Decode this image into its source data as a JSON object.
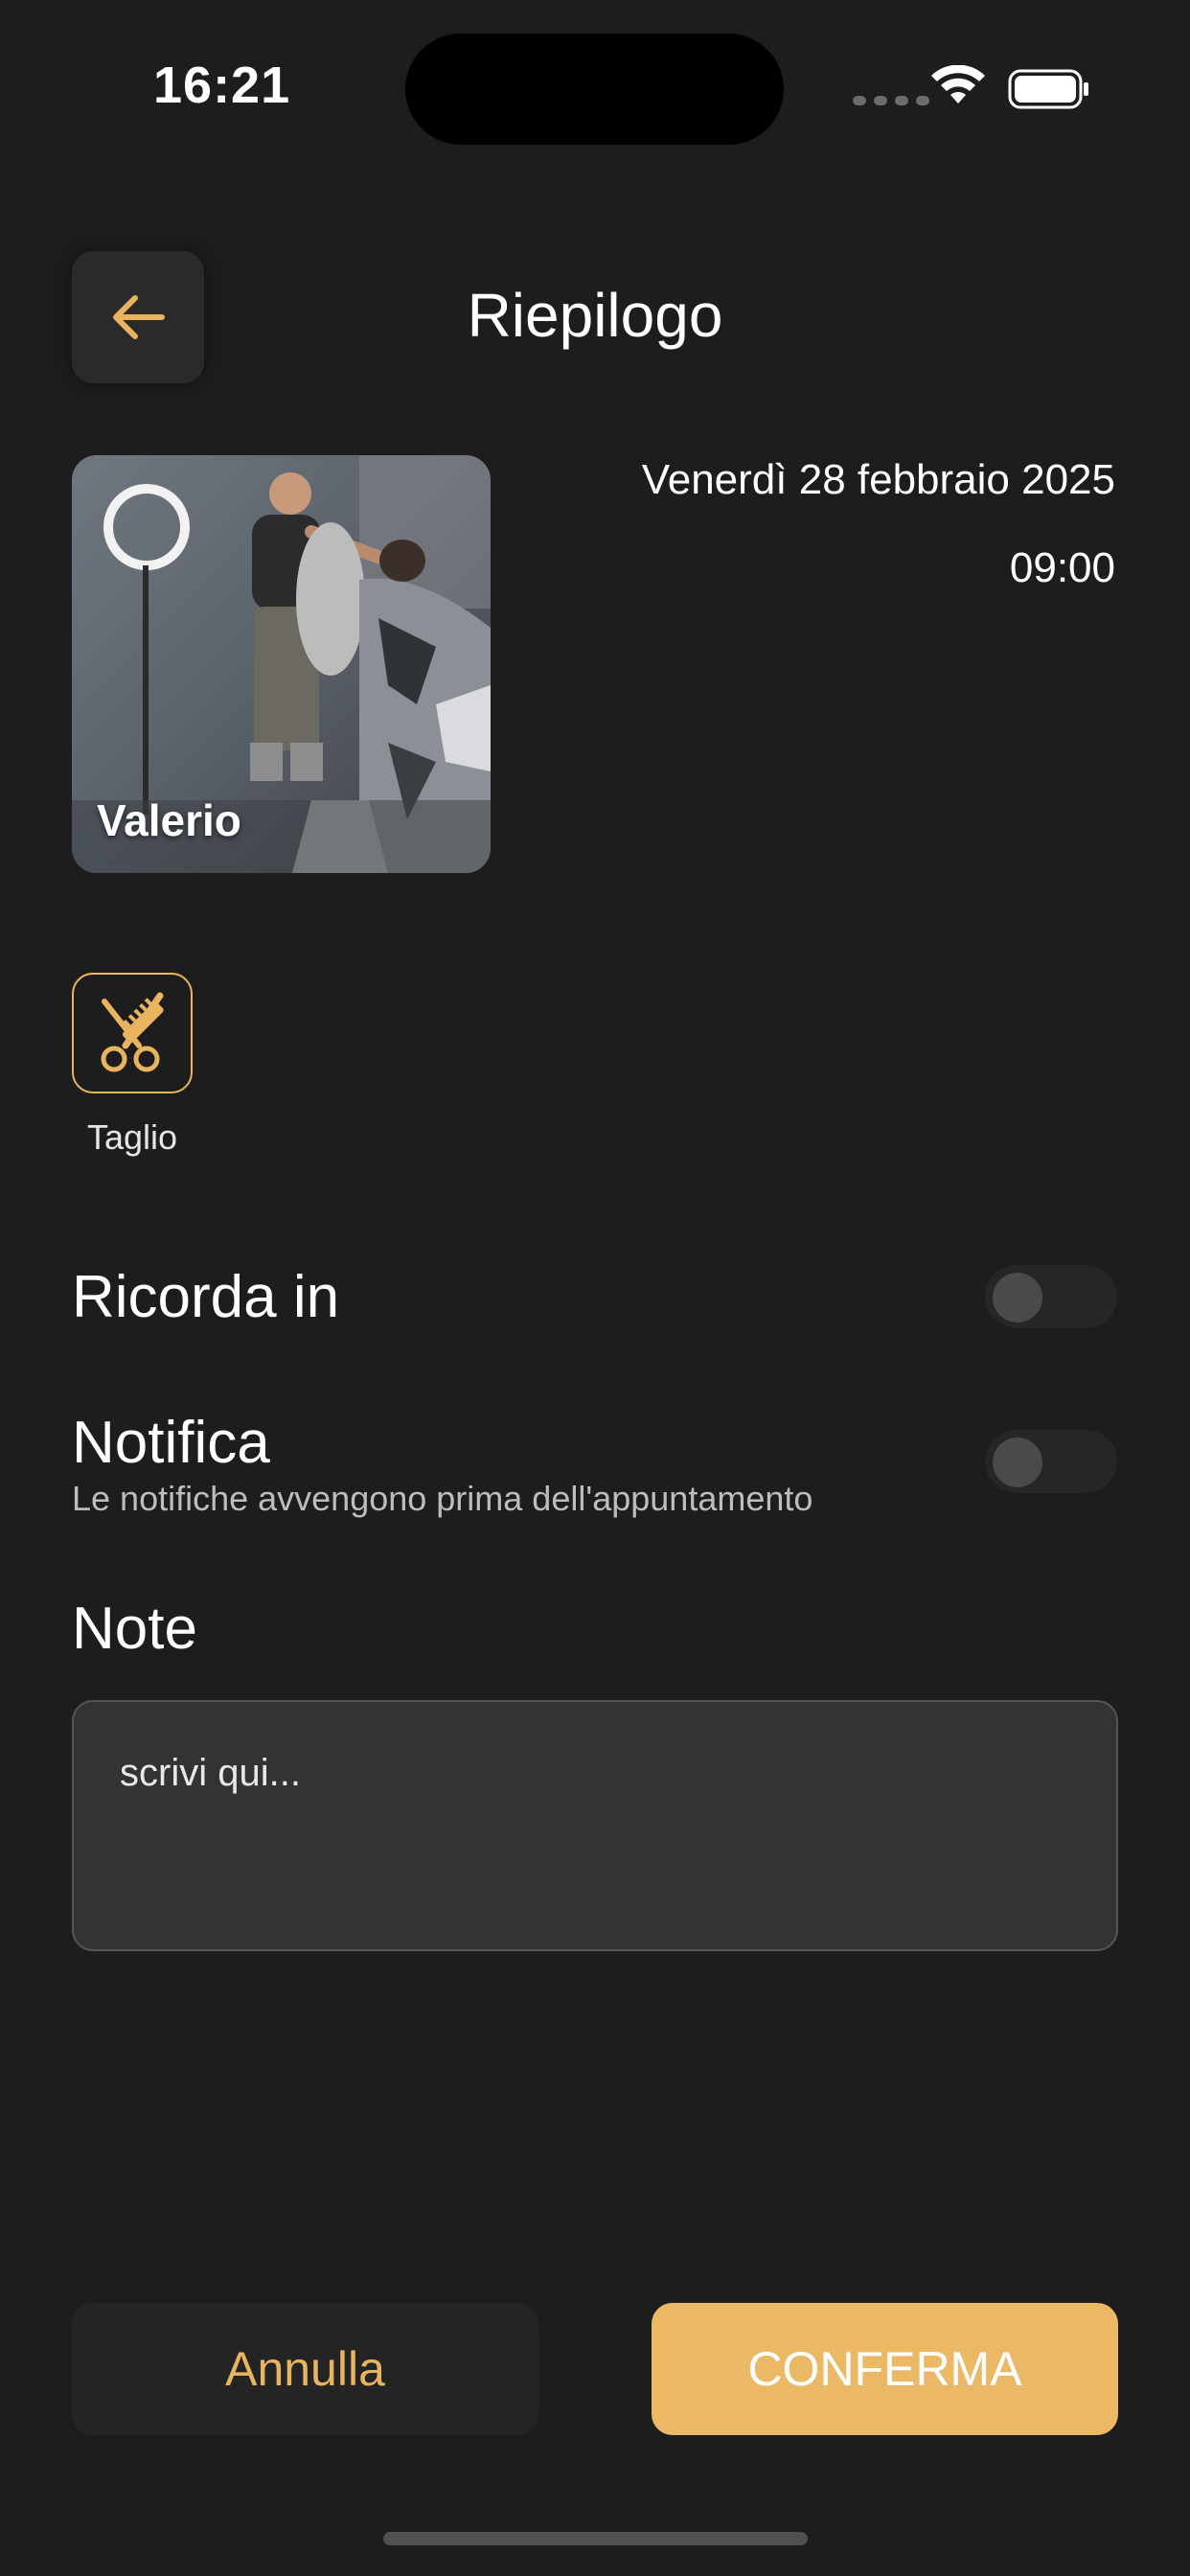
{
  "status_bar": {
    "time": "16:21"
  },
  "header": {
    "title": "Riepilogo",
    "back_icon": "arrow-left-icon"
  },
  "appointment": {
    "barber_name": "Valerio",
    "date": "Venerdì 28 febbraio 2025",
    "time": "09:00"
  },
  "service": {
    "icon": "scissors-comb-icon",
    "label": "Taglio"
  },
  "settings": {
    "remind_label": "Ricorda in",
    "remind_enabled": false,
    "notify_label": "Notifica",
    "notify_description": "Le notifiche avvengono prima dell'appuntamento",
    "notify_enabled": false
  },
  "note": {
    "label": "Note",
    "placeholder": "scrivi qui...",
    "value": ""
  },
  "actions": {
    "cancel_label": "Annulla",
    "confirm_label": "CONFERMA"
  },
  "colors": {
    "background": "#1d1d1d",
    "accent": "#ebb866",
    "card": "#333333"
  }
}
